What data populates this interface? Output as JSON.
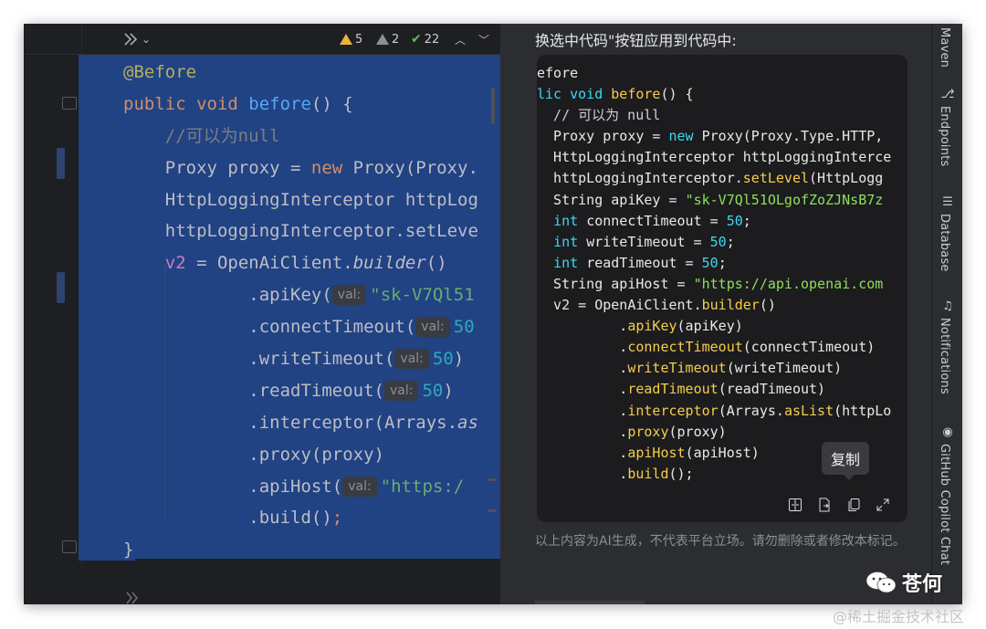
{
  "toolbar": {
    "warnings": "5",
    "weak_warnings": "2",
    "typos": "22"
  },
  "editor": {
    "lines": [
      {
        "parts": [
          [
            "anno",
            "@Before"
          ]
        ]
      },
      {
        "parts": [
          [
            "kw",
            "public void "
          ],
          [
            "fn",
            "before"
          ],
          [
            "plain",
            "() {"
          ]
        ]
      },
      {
        "parts": [
          [
            "plain",
            "    "
          ],
          [
            "cmt",
            "//可以为null"
          ]
        ]
      },
      {
        "parts": [
          [
            "plain",
            "    Proxy proxy = "
          ],
          [
            "kw",
            "new "
          ],
          [
            "plain",
            "Proxy(Proxy."
          ]
        ]
      },
      {
        "parts": [
          [
            "plain",
            "    HttpLoggingInterceptor httpLog"
          ]
        ]
      },
      {
        "parts": [
          [
            "plain",
            "    httpLoggingInterceptor.setLeve"
          ]
        ]
      },
      {
        "parts": [
          [
            "plain",
            "    "
          ],
          [
            "fld",
            "v2"
          ],
          [
            "plain",
            " = OpenAiClient."
          ],
          [
            "ital",
            "builder"
          ],
          [
            "plain",
            "()"
          ]
        ]
      },
      {
        "parts": [
          [
            "plain",
            "            .apiKey("
          ],
          [
            "hint",
            "val:"
          ],
          [
            "str",
            "\"sk-V7Ql51"
          ]
        ]
      },
      {
        "parts": [
          [
            "plain",
            "            .connectTimeout("
          ],
          [
            "hint",
            "val:"
          ],
          [
            "num",
            "50"
          ]
        ]
      },
      {
        "parts": [
          [
            "plain",
            "            .writeTimeout("
          ],
          [
            "hint",
            "val:"
          ],
          [
            "num",
            "50"
          ],
          [
            "plain",
            ")"
          ]
        ]
      },
      {
        "parts": [
          [
            "plain",
            "            .readTimeout("
          ],
          [
            "hint",
            "val:"
          ],
          [
            "num",
            "50"
          ],
          [
            "plain",
            ")"
          ]
        ]
      },
      {
        "parts": [
          [
            "plain",
            "            .interceptor(Arrays."
          ],
          [
            "ital",
            "as"
          ]
        ]
      },
      {
        "parts": [
          [
            "plain",
            "            .proxy(proxy)"
          ]
        ]
      },
      {
        "parts": [
          [
            "plain",
            "            .apiHost("
          ],
          [
            "hint",
            "val:"
          ],
          [
            "str",
            "\"https:/"
          ]
        ]
      },
      {
        "parts": [
          [
            "plain",
            "            .build()"
          ],
          [
            "kw",
            ";"
          ]
        ]
      },
      {
        "parts": [
          [
            "plain",
            "}"
          ]
        ]
      }
    ]
  },
  "panel": {
    "header": "换选中代码\"按钮应用到代码中:",
    "code_lines": [
      {
        "parts": [
          [
            "plain",
            "efore"
          ]
        ]
      },
      {
        "parts": [
          [
            "c-kw",
            "lic void "
          ],
          [
            "c-fn",
            "before"
          ],
          [
            "plain",
            "() {"
          ]
        ]
      },
      {
        "parts": [
          [
            "c-cmt",
            "  // 可以为 null"
          ]
        ]
      },
      {
        "parts": [
          [
            "plain",
            "  Proxy proxy = "
          ],
          [
            "c-kw",
            "new "
          ],
          [
            "plain",
            "Proxy(Proxy.Type.HTTP, "
          ]
        ]
      },
      {
        "parts": [
          [
            "plain",
            "  HttpLoggingInterceptor httpLoggingInterce"
          ]
        ]
      },
      {
        "parts": [
          [
            "plain",
            "  httpLoggingInterceptor."
          ],
          [
            "c-fn",
            "setLevel"
          ],
          [
            "plain",
            "(HttpLogg"
          ]
        ]
      },
      {
        "parts": [
          [
            "plain",
            "  String apiKey = "
          ],
          [
            "c-str",
            "\"sk-V7Ql51OLgofZoZJNsB7z"
          ]
        ]
      },
      {
        "parts": [
          [
            "plain",
            "  "
          ],
          [
            "c-kw",
            "int "
          ],
          [
            "plain",
            "connectTimeout = "
          ],
          [
            "c-num",
            "50"
          ],
          [
            "plain",
            ";"
          ]
        ]
      },
      {
        "parts": [
          [
            "plain",
            "  "
          ],
          [
            "c-kw",
            "int "
          ],
          [
            "plain",
            "writeTimeout = "
          ],
          [
            "c-num",
            "50"
          ],
          [
            "plain",
            ";"
          ]
        ]
      },
      {
        "parts": [
          [
            "plain",
            "  "
          ],
          [
            "c-kw",
            "int "
          ],
          [
            "plain",
            "readTimeout = "
          ],
          [
            "c-num",
            "50"
          ],
          [
            "plain",
            ";"
          ]
        ]
      },
      {
        "parts": [
          [
            "plain",
            "  String apiHost = "
          ],
          [
            "c-str",
            "\"https://api.openai.com"
          ]
        ]
      },
      {
        "parts": [
          [
            "plain",
            "  v2 = OpenAiClient."
          ],
          [
            "c-fn",
            "builder"
          ],
          [
            "plain",
            "()"
          ]
        ]
      },
      {
        "parts": [
          [
            "plain",
            "          ."
          ],
          [
            "c-fn",
            "apiKey"
          ],
          [
            "plain",
            "(apiKey)"
          ]
        ]
      },
      {
        "parts": [
          [
            "plain",
            "          ."
          ],
          [
            "c-fn",
            "connectTimeout"
          ],
          [
            "plain",
            "(connectTimeout)"
          ]
        ]
      },
      {
        "parts": [
          [
            "plain",
            "          ."
          ],
          [
            "c-fn",
            "writeTimeout"
          ],
          [
            "plain",
            "(writeTimeout)"
          ]
        ]
      },
      {
        "parts": [
          [
            "plain",
            "          ."
          ],
          [
            "c-fn",
            "readTimeout"
          ],
          [
            "plain",
            "(readTimeout)"
          ]
        ]
      },
      {
        "parts": [
          [
            "plain",
            "          ."
          ],
          [
            "c-fn",
            "interceptor"
          ],
          [
            "plain",
            "(Arrays."
          ],
          [
            "c-fn",
            "asList"
          ],
          [
            "plain",
            "(httpLo"
          ]
        ]
      },
      {
        "parts": [
          [
            "plain",
            "          ."
          ],
          [
            "c-fn",
            "proxy"
          ],
          [
            "plain",
            "(proxy)"
          ]
        ]
      },
      {
        "parts": [
          [
            "plain",
            "          ."
          ],
          [
            "c-fn",
            "apiHost"
          ],
          [
            "plain",
            "(apiHost)"
          ]
        ]
      },
      {
        "parts": [
          [
            "plain",
            "          ."
          ],
          [
            "c-fn",
            "build"
          ],
          [
            "plain",
            "();"
          ]
        ]
      }
    ],
    "tooltip": "复制",
    "disclaimer": "以上内容为AI生成，不代表平台立场。请勿删除或者修改本标记。"
  },
  "toolwindows": [
    "Maven",
    "Endpoints",
    "Database",
    "Notifications",
    "GitHub Copilot Chat"
  ],
  "watermark": {
    "account": "苍何",
    "site": "@稀土掘金技术社区"
  }
}
